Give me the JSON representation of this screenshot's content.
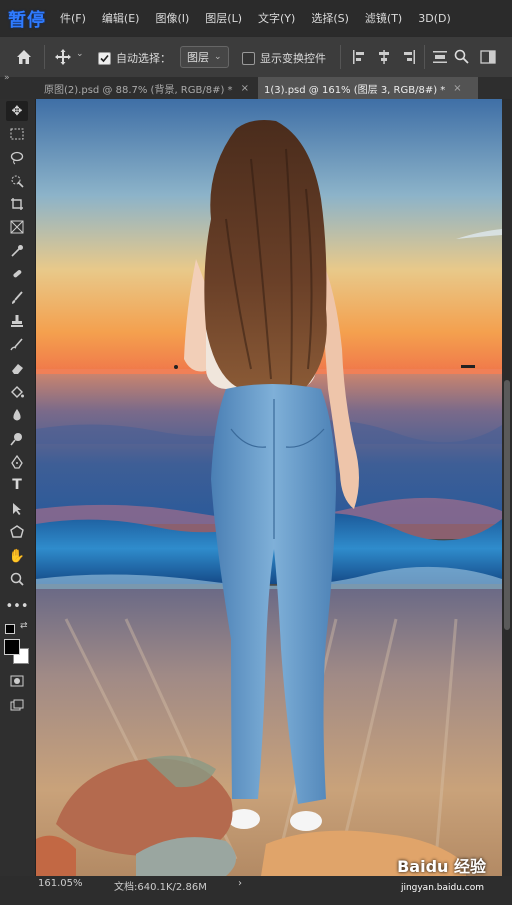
{
  "overlay": {
    "pause_label": "暂停"
  },
  "menu": {
    "items": [
      "件(F)",
      "编辑(E)",
      "图像(I)",
      "图层(L)",
      "文字(Y)",
      "选择(S)",
      "滤镜(T)",
      "3D(D)"
    ]
  },
  "options": {
    "auto_select_label": "自动选择：",
    "auto_select_checked": true,
    "layer_dropdown": "图层",
    "show_transform_label": "显示变换控件"
  },
  "tabs": [
    {
      "label": "原图(2).psd @ 88.7% (背景, RGB/8#) *",
      "active": false
    },
    {
      "label": "1(3).psd @ 161% (图层 3, RGB/8#) *",
      "active": true
    }
  ],
  "status": {
    "zoom": "161.05%",
    "doc": "文档:640.1K/2.86M",
    "arrow": "›"
  },
  "watermark": {
    "brand": "Baidu 经验",
    "url": "jingyan.baidu.com"
  },
  "colors": {
    "accent": "#2f7bff",
    "foreground": "#000000",
    "background": "#ffffff"
  }
}
